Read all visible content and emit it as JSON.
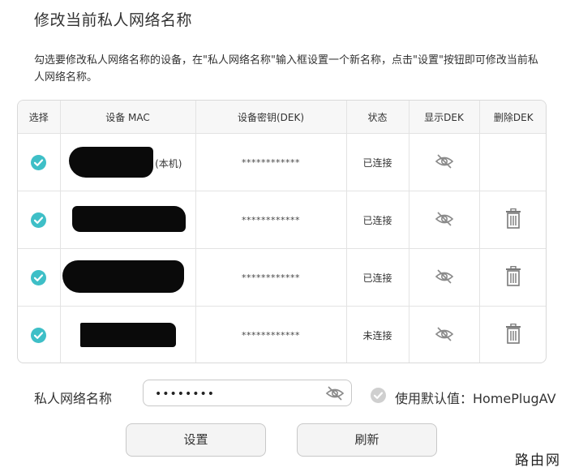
{
  "page": {
    "title": "修改当前私人网络名称",
    "description": "勾选要修改私人网络名称的设备，在\"私人网络名称\"输入框设置一个新名称，点击\"设置\"按钮即可修改当前私人网络名称。"
  },
  "table": {
    "headers": [
      "选择",
      "设备 MAC",
      "设备密钥(DEK)",
      "状态",
      "显示DEK",
      "删除DEK"
    ],
    "rows": [
      {
        "checked": true,
        "mac_suffix": "(本机)",
        "dek": "************",
        "status": "已连接",
        "deletable": false
      },
      {
        "checked": true,
        "mac_suffix": "",
        "dek": "************",
        "status": "已连接",
        "deletable": true
      },
      {
        "checked": true,
        "mac_suffix": "",
        "dek": "************",
        "status": "已连接",
        "deletable": true
      },
      {
        "checked": true,
        "mac_suffix": "",
        "dek": "************",
        "status": "未连接",
        "deletable": true
      }
    ]
  },
  "form": {
    "label": "私人网络名称",
    "password_value": "••••••••",
    "default_label": "使用默认值：HomePlugAV",
    "default_checked": false
  },
  "buttons": {
    "set_label": "设置",
    "refresh_label": "刷新"
  },
  "watermark": "路由网",
  "colors": {
    "accent": "#3ebfc7",
    "icon_gray": "#888888",
    "border": "#d9d9d9"
  },
  "icons": {
    "check": "check-circle-icon",
    "eye_hidden": "eye-off-icon",
    "delete": "trash-icon"
  }
}
